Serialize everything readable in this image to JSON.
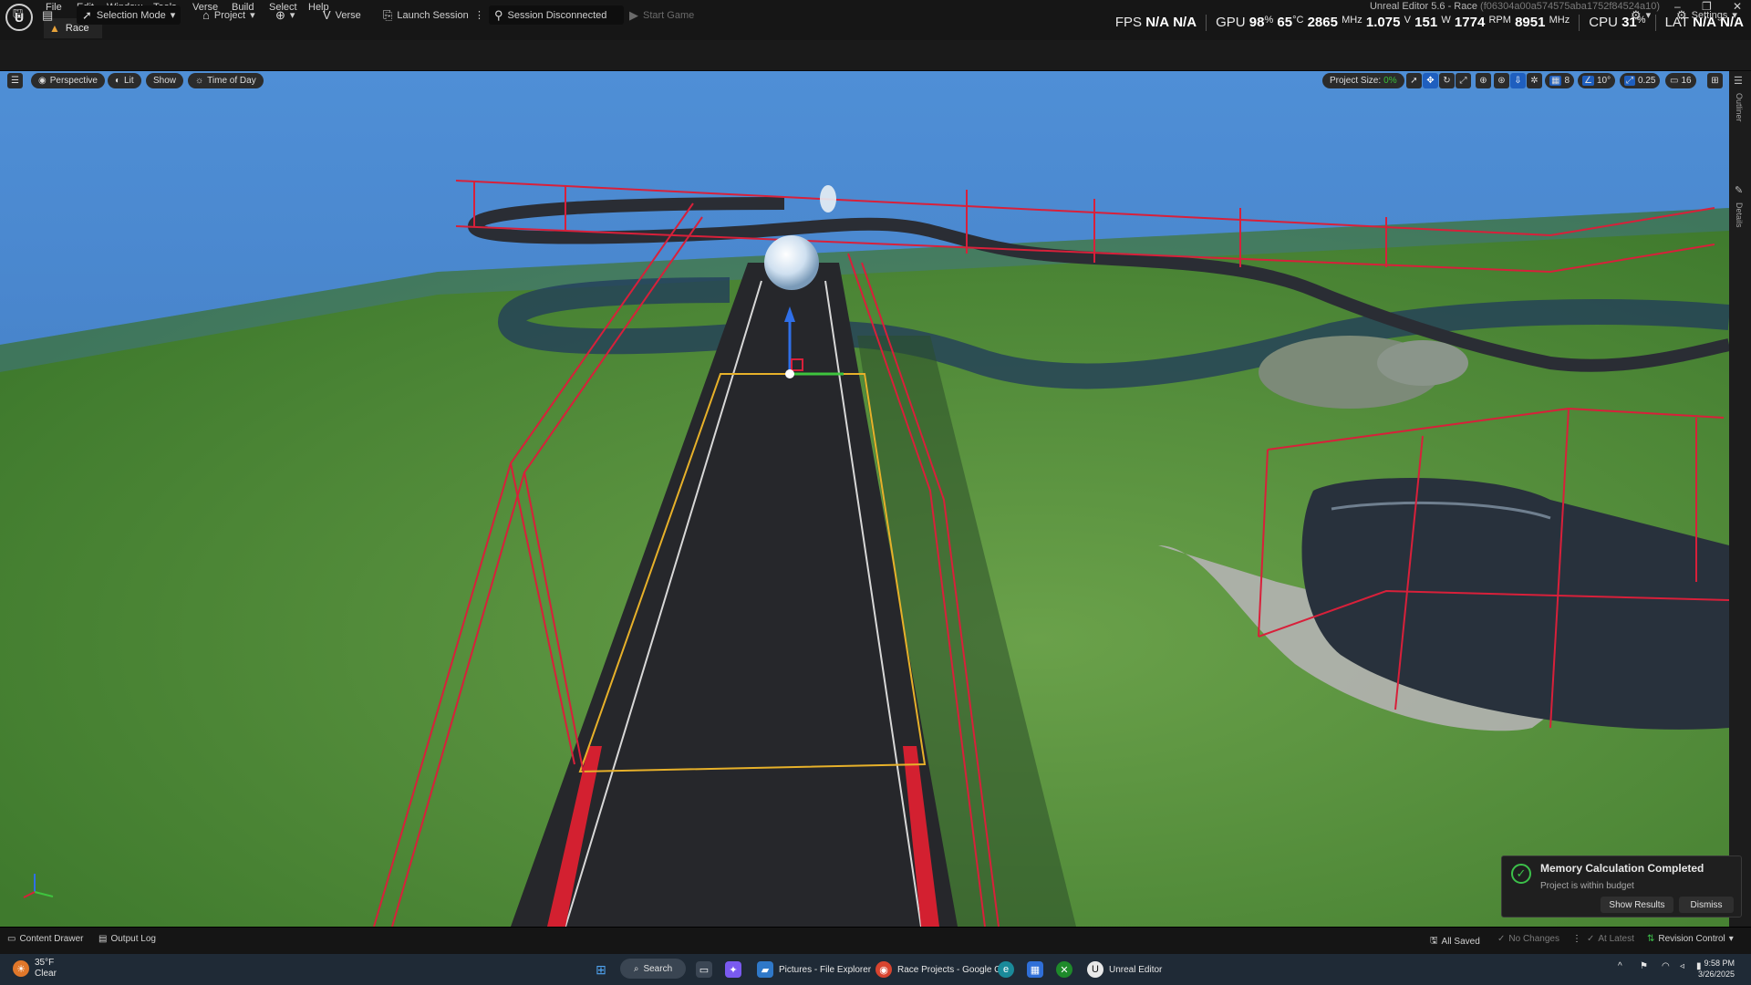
{
  "app": {
    "menu": [
      "File",
      "Edit",
      "Window",
      "Tools",
      "Verse",
      "Build",
      "Select",
      "Help"
    ],
    "tab_label": "Race",
    "window_title": "Unreal Editor 5.6 - Race",
    "window_hash": "(f06304a00a574575aba1752f84524a10)"
  },
  "stats": {
    "fps_label": "FPS",
    "fps1": "N/A",
    "fps2": "N/A",
    "gpu_label": "GPU",
    "gpu_load": "98",
    "gpu_load_unit": "%",
    "gpu_temp": "65",
    "gpu_temp_unit": "°C",
    "gpu_clock": "2865",
    "gpu_clock_unit": "MHz",
    "gpu_volt": "1.075",
    "gpu_volt_unit": "V",
    "gpu_power": "151",
    "gpu_power_unit": "W",
    "gpu_fan": "1774",
    "gpu_fan_unit": "RPM",
    "gpu_mem": "8951",
    "gpu_mem_unit": "MHz",
    "cpu_label": "CPU",
    "cpu_load": "31",
    "cpu_unit": "%",
    "lat_label": "LAT",
    "lat1": "N/A",
    "lat2": "N/A"
  },
  "toolbar": {
    "selection_mode": "Selection Mode",
    "project": "Project",
    "verse": "Verse",
    "launch_session": "Launch Session",
    "session_status": "Session Disconnected",
    "start_game": "Start Game",
    "settings": "Settings"
  },
  "viewport": {
    "perspective": "Perspective",
    "lit": "Lit",
    "show": "Show",
    "time_of_day": "Time of Day",
    "project_size_label": "Project Size:",
    "project_size_value": "0%",
    "grid_snap": "8",
    "rot_snap": "10°",
    "scale_snap": "0.25",
    "camera_speed": "16",
    "side_tab_outliner": "Outliner",
    "side_tab_details": "Details"
  },
  "toast": {
    "title": "Memory Calculation Completed",
    "subtitle": "Project is within budget",
    "show_results": "Show Results",
    "dismiss": "Dismiss"
  },
  "statusbar": {
    "content_drawer": "Content Drawer",
    "output_log": "Output Log",
    "all_saved": "All Saved",
    "no_changes": "No Changes",
    "at_latest": "At Latest",
    "revision_control": "Revision Control"
  },
  "taskbar": {
    "weather_temp": "35°F",
    "weather_desc": "Clear",
    "search": "Search",
    "file_explorer": "Pictures - File Explorer",
    "chrome": "Race Projects - Google C",
    "unreal": "Unreal Editor",
    "time": "9:58 PM",
    "date": "3/26/2025"
  },
  "colors": {
    "sky": "#3c77c2",
    "grass": "#4f8a38",
    "road": "#26272b",
    "barrier": "#d8203a",
    "accent_blue": "#1f5fbf",
    "success_green": "#3cc04a"
  }
}
